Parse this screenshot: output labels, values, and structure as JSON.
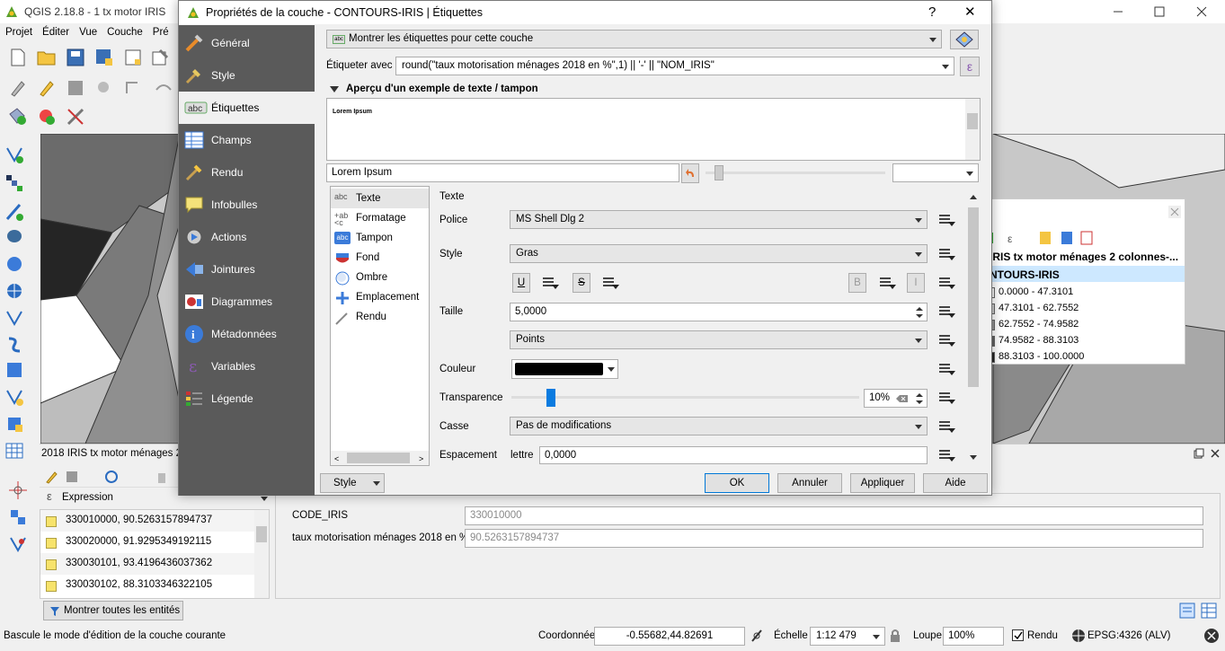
{
  "app": {
    "title": "QGIS 2.18.8 - 1 tx motor IRIS",
    "menus": [
      "Projet",
      "Éditer",
      "Vue",
      "Couche",
      "Pré"
    ]
  },
  "dialog": {
    "title": "Propriétés de la couche - CONTOURS-IRIS | Étiquettes",
    "help": "?",
    "close": "✕",
    "nav": [
      "Général",
      "Style",
      "Étiquettes",
      "Champs",
      "Rendu",
      "Infobulles",
      "Actions",
      "Jointures",
      "Diagrammes",
      "Métadonnées",
      "Variables",
      "Légende"
    ],
    "label_mode": "Montrer les étiquettes pour cette couche",
    "label_with_caption": "Étiqueter avec",
    "label_expression": "round(\"taux motorisation ménages 2018 en %\",1)  || '-' || \"NOM_IRIS\"",
    "preview_header": "Aperçu d'un exemple de texte / tampon",
    "preview_text": "Lorem Ipsum",
    "preview_input": "Lorem Ipsum",
    "subtabs": [
      "Texte",
      "Formatage",
      "Tampon",
      "Fond",
      "Ombre",
      "Emplacement",
      "Rendu"
    ],
    "text_section": "Texte",
    "police_label": "Police",
    "police_value": "MS Shell Dlg 2",
    "style_label": "Style",
    "style_value": "Gras",
    "u": "U",
    "s": "S",
    "b": "B",
    "i": "I",
    "taille_label": "Taille",
    "taille_value": "5,0000",
    "unit_value": "Points",
    "couleur_label": "Couleur",
    "transparence_label": "Transparence",
    "transparence_value": "10%",
    "transparence_level": 0.1,
    "casse_label": "Casse",
    "casse_value": "Pas de modifications",
    "espacement_label": "Espacement",
    "lettre_label": "lettre",
    "lettre_value": "0,0000",
    "buttons": {
      "style": "Style",
      "ok": "OK",
      "annuler": "Annuler",
      "appliquer": "Appliquer",
      "aide": "Aide"
    }
  },
  "legend_panel": {
    "header": "IRIS tx motor ménages 2 colonnes-...",
    "layer": "NTOURS-IRIS",
    "classes": [
      {
        "label": "0.0000 - 47.3101",
        "color": "#f7f7f7"
      },
      {
        "label": "47.3101 - 62.7552",
        "color": "#cccccc"
      },
      {
        "label": "62.7552 - 74.9582",
        "color": "#969696"
      },
      {
        "label": "74.9582 - 88.3103",
        "color": "#636363"
      },
      {
        "label": "88.3103 - 100.0000",
        "color": "#252525"
      }
    ]
  },
  "attr_panel": {
    "title": "2018 IRIS tx motor ménages 2 c",
    "expression_label": "Expression",
    "rows": [
      "330010000, 90.5263157894737",
      "330020000, 91.9295349192115",
      "330030101, 93.4196436037362",
      "330030102, 88.3103346322105"
    ],
    "show_all": "Montrer toutes les entités",
    "fields": [
      {
        "label": "CODE_IRIS",
        "value": "330010000"
      },
      {
        "label": "taux motorisation ménages 2018 en %",
        "value": "90.5263157894737"
      }
    ]
  },
  "status": {
    "message": "Bascule le mode d'édition de la couche courante",
    "coord_label": "Coordonnée",
    "coord_value": "-0.55682,44.82691",
    "scale_label": "Échelle",
    "scale_value": "1:12 479",
    "loupe_label": "Loupe",
    "loupe_value": "100%",
    "rendu_label": "Rendu",
    "epsg": "EPSG:4326 (ALV)"
  }
}
